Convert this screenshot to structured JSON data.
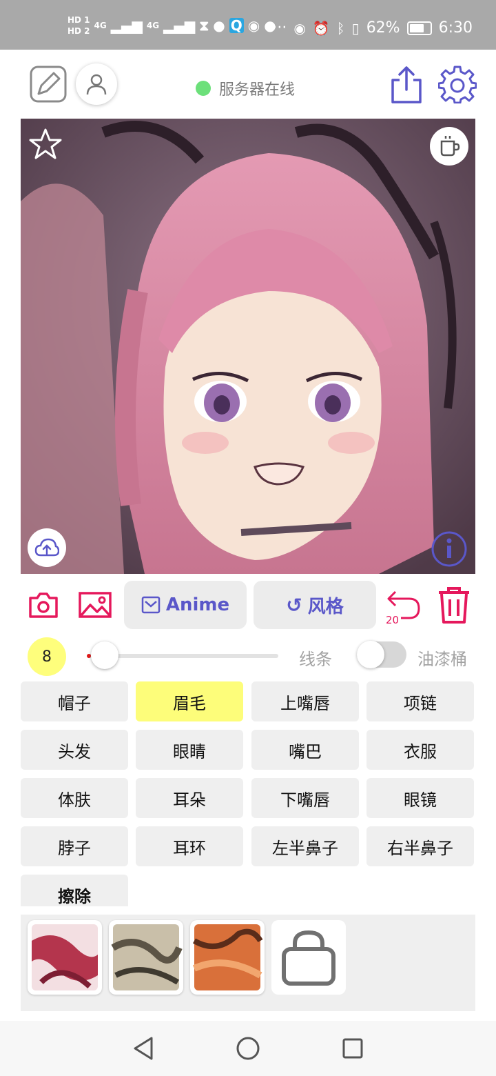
{
  "status_bar": {
    "sim1": "HD 1",
    "sim2": "HD 2",
    "net1": "4G",
    "net2": "4G",
    "more": "···",
    "battery_percent": "62%",
    "time": "6:30"
  },
  "header": {
    "server_status": "服务器在线",
    "server_color": "#6ce07a",
    "accent": "#5a57c9"
  },
  "toolbar": {
    "anime_label": "Anime",
    "style_label": "风格",
    "undo_count": "20",
    "accent_red": "#e5185c"
  },
  "brush": {
    "size": "8",
    "slider_value": 0.02,
    "line_label": "线条",
    "bucket_label": "油漆桶",
    "bucket_on": false
  },
  "parts": [
    {
      "label": "帽子",
      "active": false
    },
    {
      "label": "眉毛",
      "active": true
    },
    {
      "label": "上嘴唇",
      "active": false
    },
    {
      "label": "项链",
      "active": false
    },
    {
      "label": "头发",
      "active": false
    },
    {
      "label": "眼睛",
      "active": false
    },
    {
      "label": "嘴巴",
      "active": false
    },
    {
      "label": "衣服",
      "active": false
    },
    {
      "label": "体肤",
      "active": false
    },
    {
      "label": "耳朵",
      "active": false
    },
    {
      "label": "下嘴唇",
      "active": false
    },
    {
      "label": "眼镜",
      "active": false
    },
    {
      "label": "脖子",
      "active": false
    },
    {
      "label": "耳环",
      "active": false
    },
    {
      "label": "左半鼻子",
      "active": false
    },
    {
      "label": "右半鼻子",
      "active": false
    }
  ],
  "erase_label": "擦除",
  "palette": {
    "swatches": [
      "#b4354d",
      "#8e8470",
      "#d9703a"
    ]
  }
}
